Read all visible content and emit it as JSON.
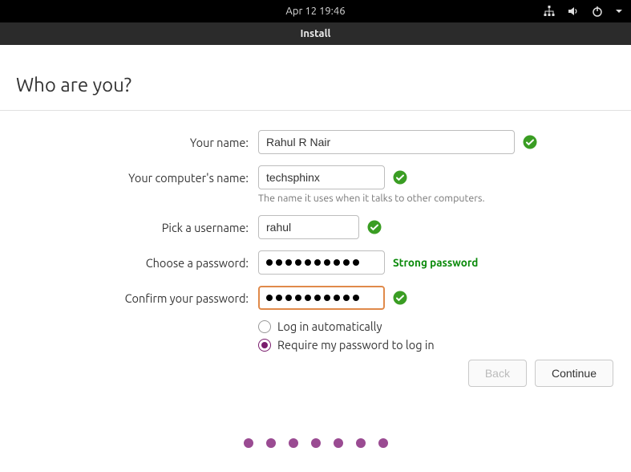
{
  "topbar": {
    "datetime": "Apr 12  19:46"
  },
  "titlebar": {
    "title": "Install"
  },
  "heading": "Who are you?",
  "labels": {
    "your_name": "Your name:",
    "computer_name": "Your computer's name:",
    "computer_hint": "The name it uses when it talks to other computers.",
    "username": "Pick a username:",
    "password": "Choose a password:",
    "confirm": "Confirm your password:"
  },
  "values": {
    "your_name": "Rahul R Nair",
    "computer_name": "techsphinx",
    "username": "rahul",
    "password_masked": "●●●●●●●●●●",
    "confirm_masked": "●●●●●●●●●●"
  },
  "password_strength": "Strong password",
  "login_options": {
    "auto": "Log in automatically",
    "require": "Require my password to log in",
    "selected": "require"
  },
  "buttons": {
    "back": "Back",
    "continue": "Continue"
  },
  "colors": {
    "accent": "#7a1e6d",
    "ok": "#3a9d23",
    "warn_border": "#e08a4a"
  },
  "progress_dots": 7,
  "icons": {
    "network": "network-icon",
    "volume": "volume-icon",
    "power": "power-icon",
    "caret": "caret-down-icon",
    "check": "check-circle-icon"
  }
}
